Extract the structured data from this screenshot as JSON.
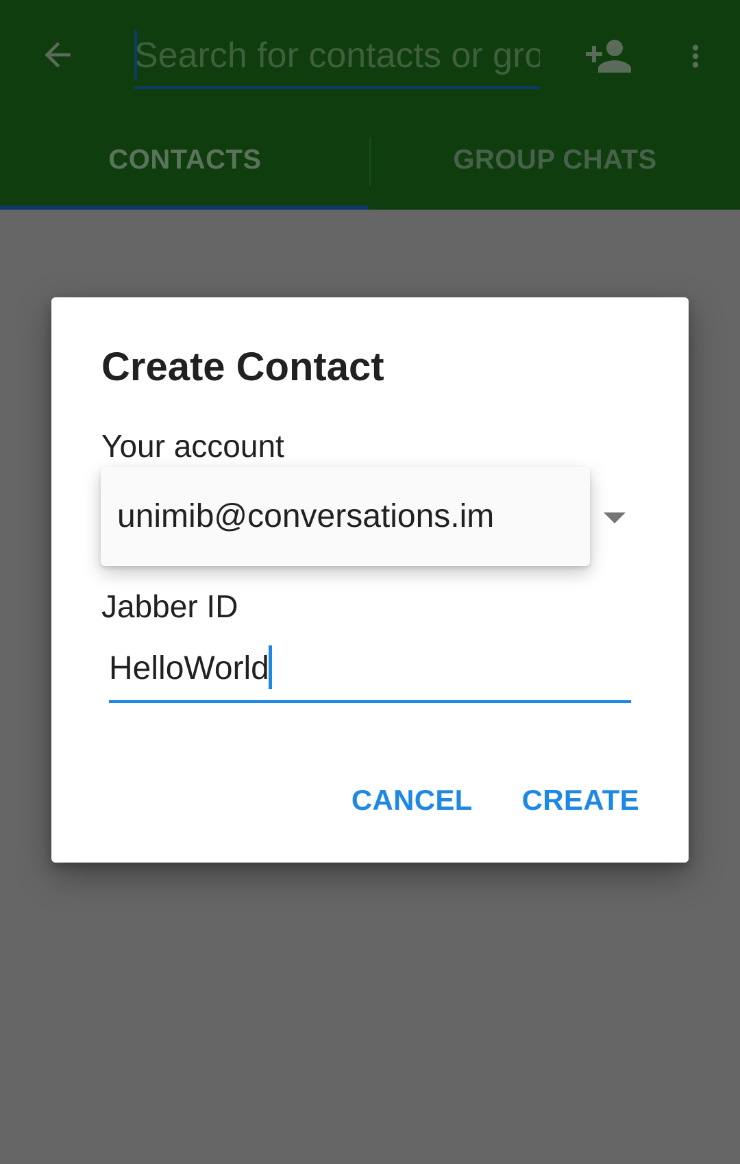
{
  "toolbar": {
    "search_placeholder": "Search for contacts or gro",
    "back_icon": "arrow-back-icon",
    "add_contact_icon": "person-add-icon",
    "overflow_icon": "more-vert-icon"
  },
  "tabs": [
    {
      "label": "CONTACTS",
      "selected": true
    },
    {
      "label": "GROUP CHATS",
      "selected": false
    }
  ],
  "dialog": {
    "title": "Create Contact",
    "account_label": "Your account",
    "account_value": "unimib@conversations.im",
    "jid_label": "Jabber ID",
    "jid_value": "HelloWorld",
    "cancel_label": "CANCEL",
    "create_label": "CREATE"
  },
  "colors": {
    "appbar": "#0f3d0e",
    "scrim": "#666666",
    "accent": "#1e88e5"
  }
}
